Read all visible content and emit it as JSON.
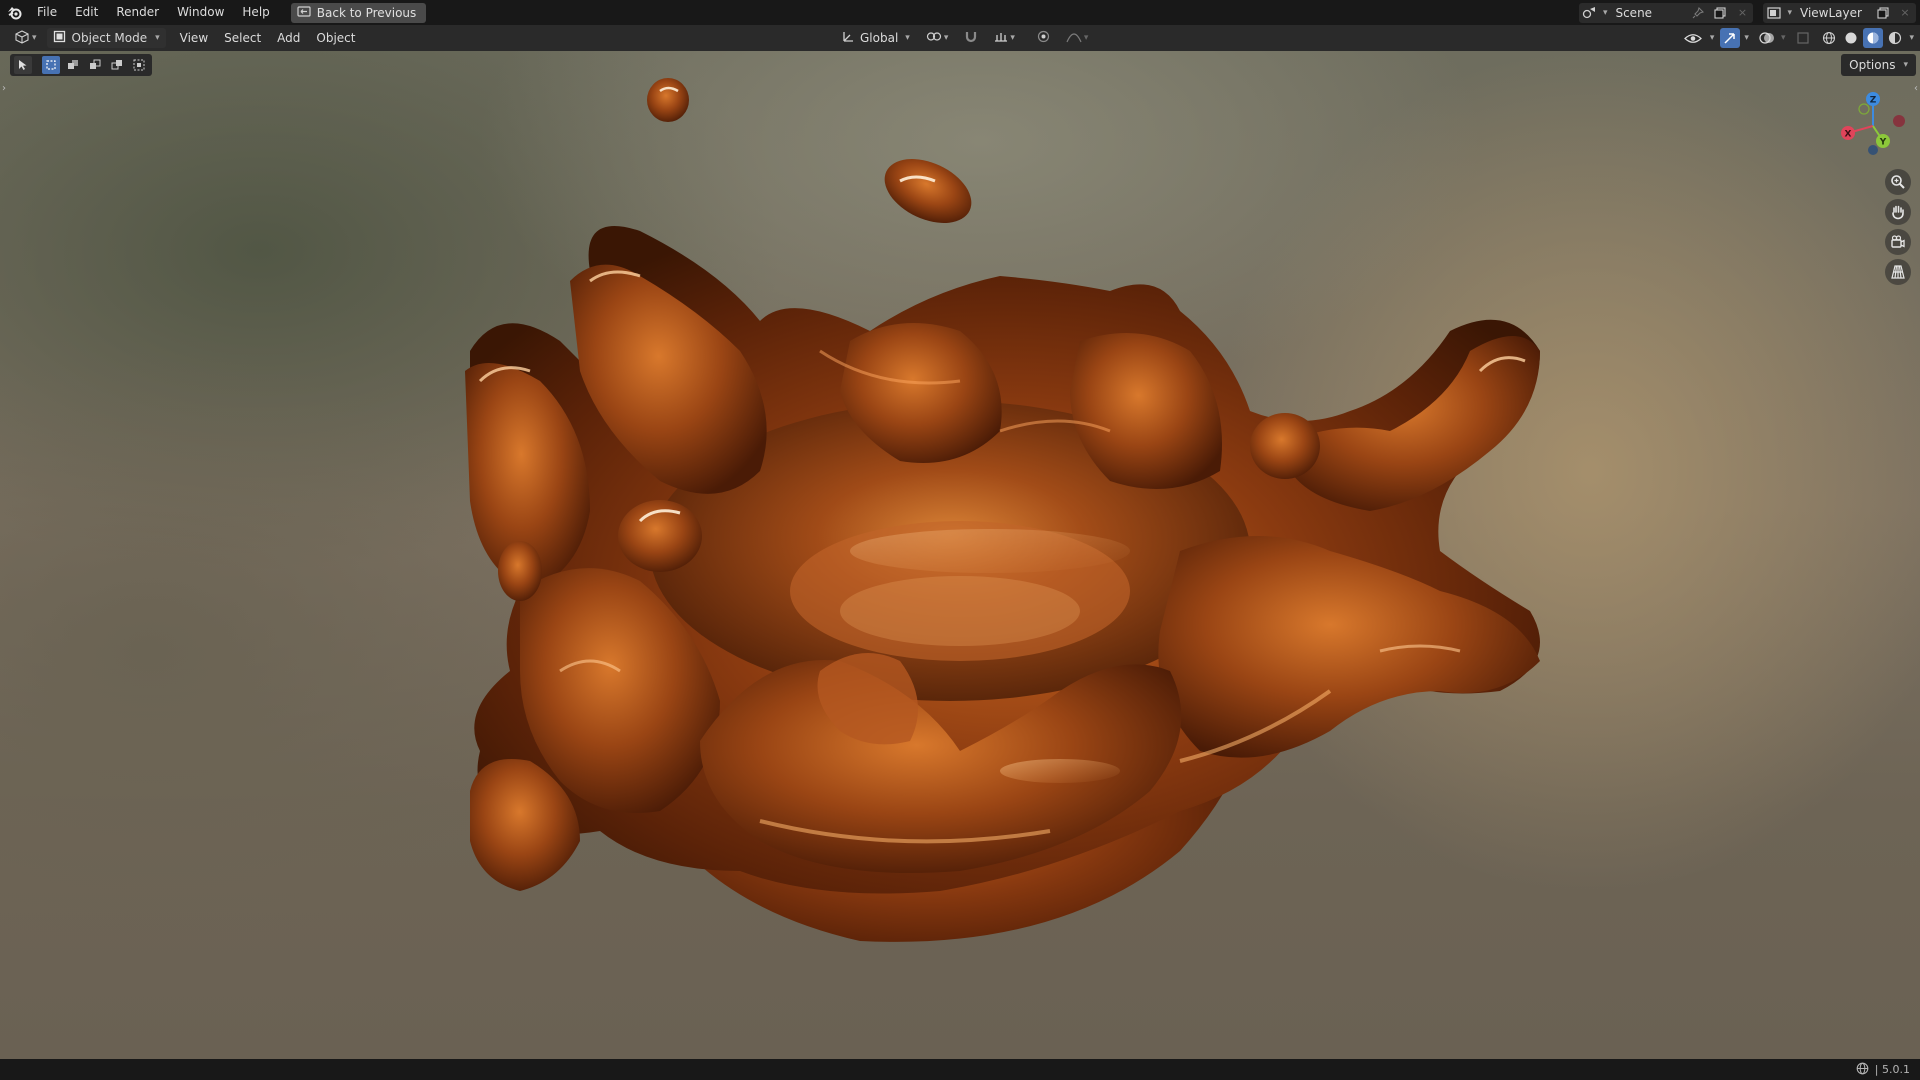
{
  "menu": {
    "items": [
      "File",
      "Edit",
      "Render",
      "Window",
      "Help"
    ],
    "back_button": "Back to Previous"
  },
  "topbar_right": {
    "scene_name": "Scene",
    "view_layer_name": "ViewLayer"
  },
  "header": {
    "mode": "Object Mode",
    "menus": [
      "View",
      "Select",
      "Add",
      "Object"
    ],
    "transform_orientation": "Global"
  },
  "viewport": {
    "options_label": "Options",
    "gizmo_axes": {
      "x": "X",
      "y": "Y",
      "z": "Z"
    },
    "object_color": "#b5551a",
    "highlight_color": "#f0a060"
  },
  "status": {
    "version": "| 5.0.1"
  }
}
